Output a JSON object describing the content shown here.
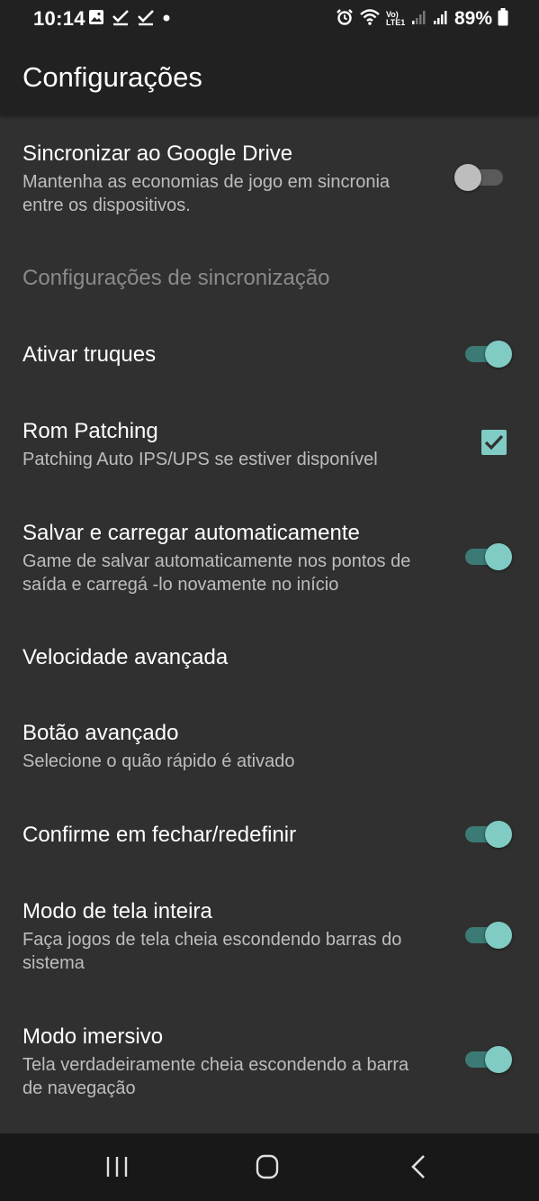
{
  "status_bar": {
    "time": "10:14",
    "battery": "89%",
    "network_label": "Vo) LTE1",
    "left_icons": [
      "image-icon",
      "check-icon",
      "check-icon",
      "dot-icon"
    ],
    "right_icons": [
      "alarm-icon",
      "wifi-icon",
      "lte-icon",
      "signal-icon",
      "signal-icon",
      "battery-icon"
    ]
  },
  "app_bar": {
    "title": "Configurações"
  },
  "settings": {
    "sync_drive": {
      "title": "Sincronizar ao Google Drive",
      "summary": "Mantenha as economias de jogo em sincronia entre os dispositivos.",
      "enabled": false
    },
    "sync_category": {
      "title": "Configurações de sincronização"
    },
    "cheats": {
      "title": "Ativar truques",
      "enabled": true
    },
    "rom_patching": {
      "title": "Rom Patching",
      "summary": "Patching Auto IPS/UPS se estiver disponível",
      "checked": true
    },
    "auto_save": {
      "title": "Salvar e carregar automaticamente",
      "summary": "Game de salvar automaticamente nos pontos de saída e carregá -lo novamente no início",
      "enabled": true
    },
    "fast_forward_speed": {
      "title": "Velocidade avançada"
    },
    "fast_forward_button": {
      "title": "Botão avançado",
      "summary": "Selecione o quão rápido é ativado"
    },
    "confirm_close": {
      "title": "Confirme em fechar/redefinir",
      "enabled": true
    },
    "fullscreen": {
      "title": "Modo de tela inteira",
      "summary": "Faça jogos de tela cheia escondendo barras do sistema",
      "enabled": true
    },
    "immersive": {
      "title": "Modo imersivo",
      "summary": "Tela verdadeiramente cheia escondendo a barra de navegação",
      "enabled": true
    }
  },
  "nav_bar": {
    "buttons": [
      "recent-apps-icon",
      "home-icon",
      "back-icon"
    ]
  },
  "colors": {
    "background": "#303030",
    "app_bar": "#212121",
    "accent": "#80cbc4",
    "accent_track": "#3c7a75",
    "summary_text": "#bdbdbd",
    "category_text": "#8a8a8a"
  }
}
